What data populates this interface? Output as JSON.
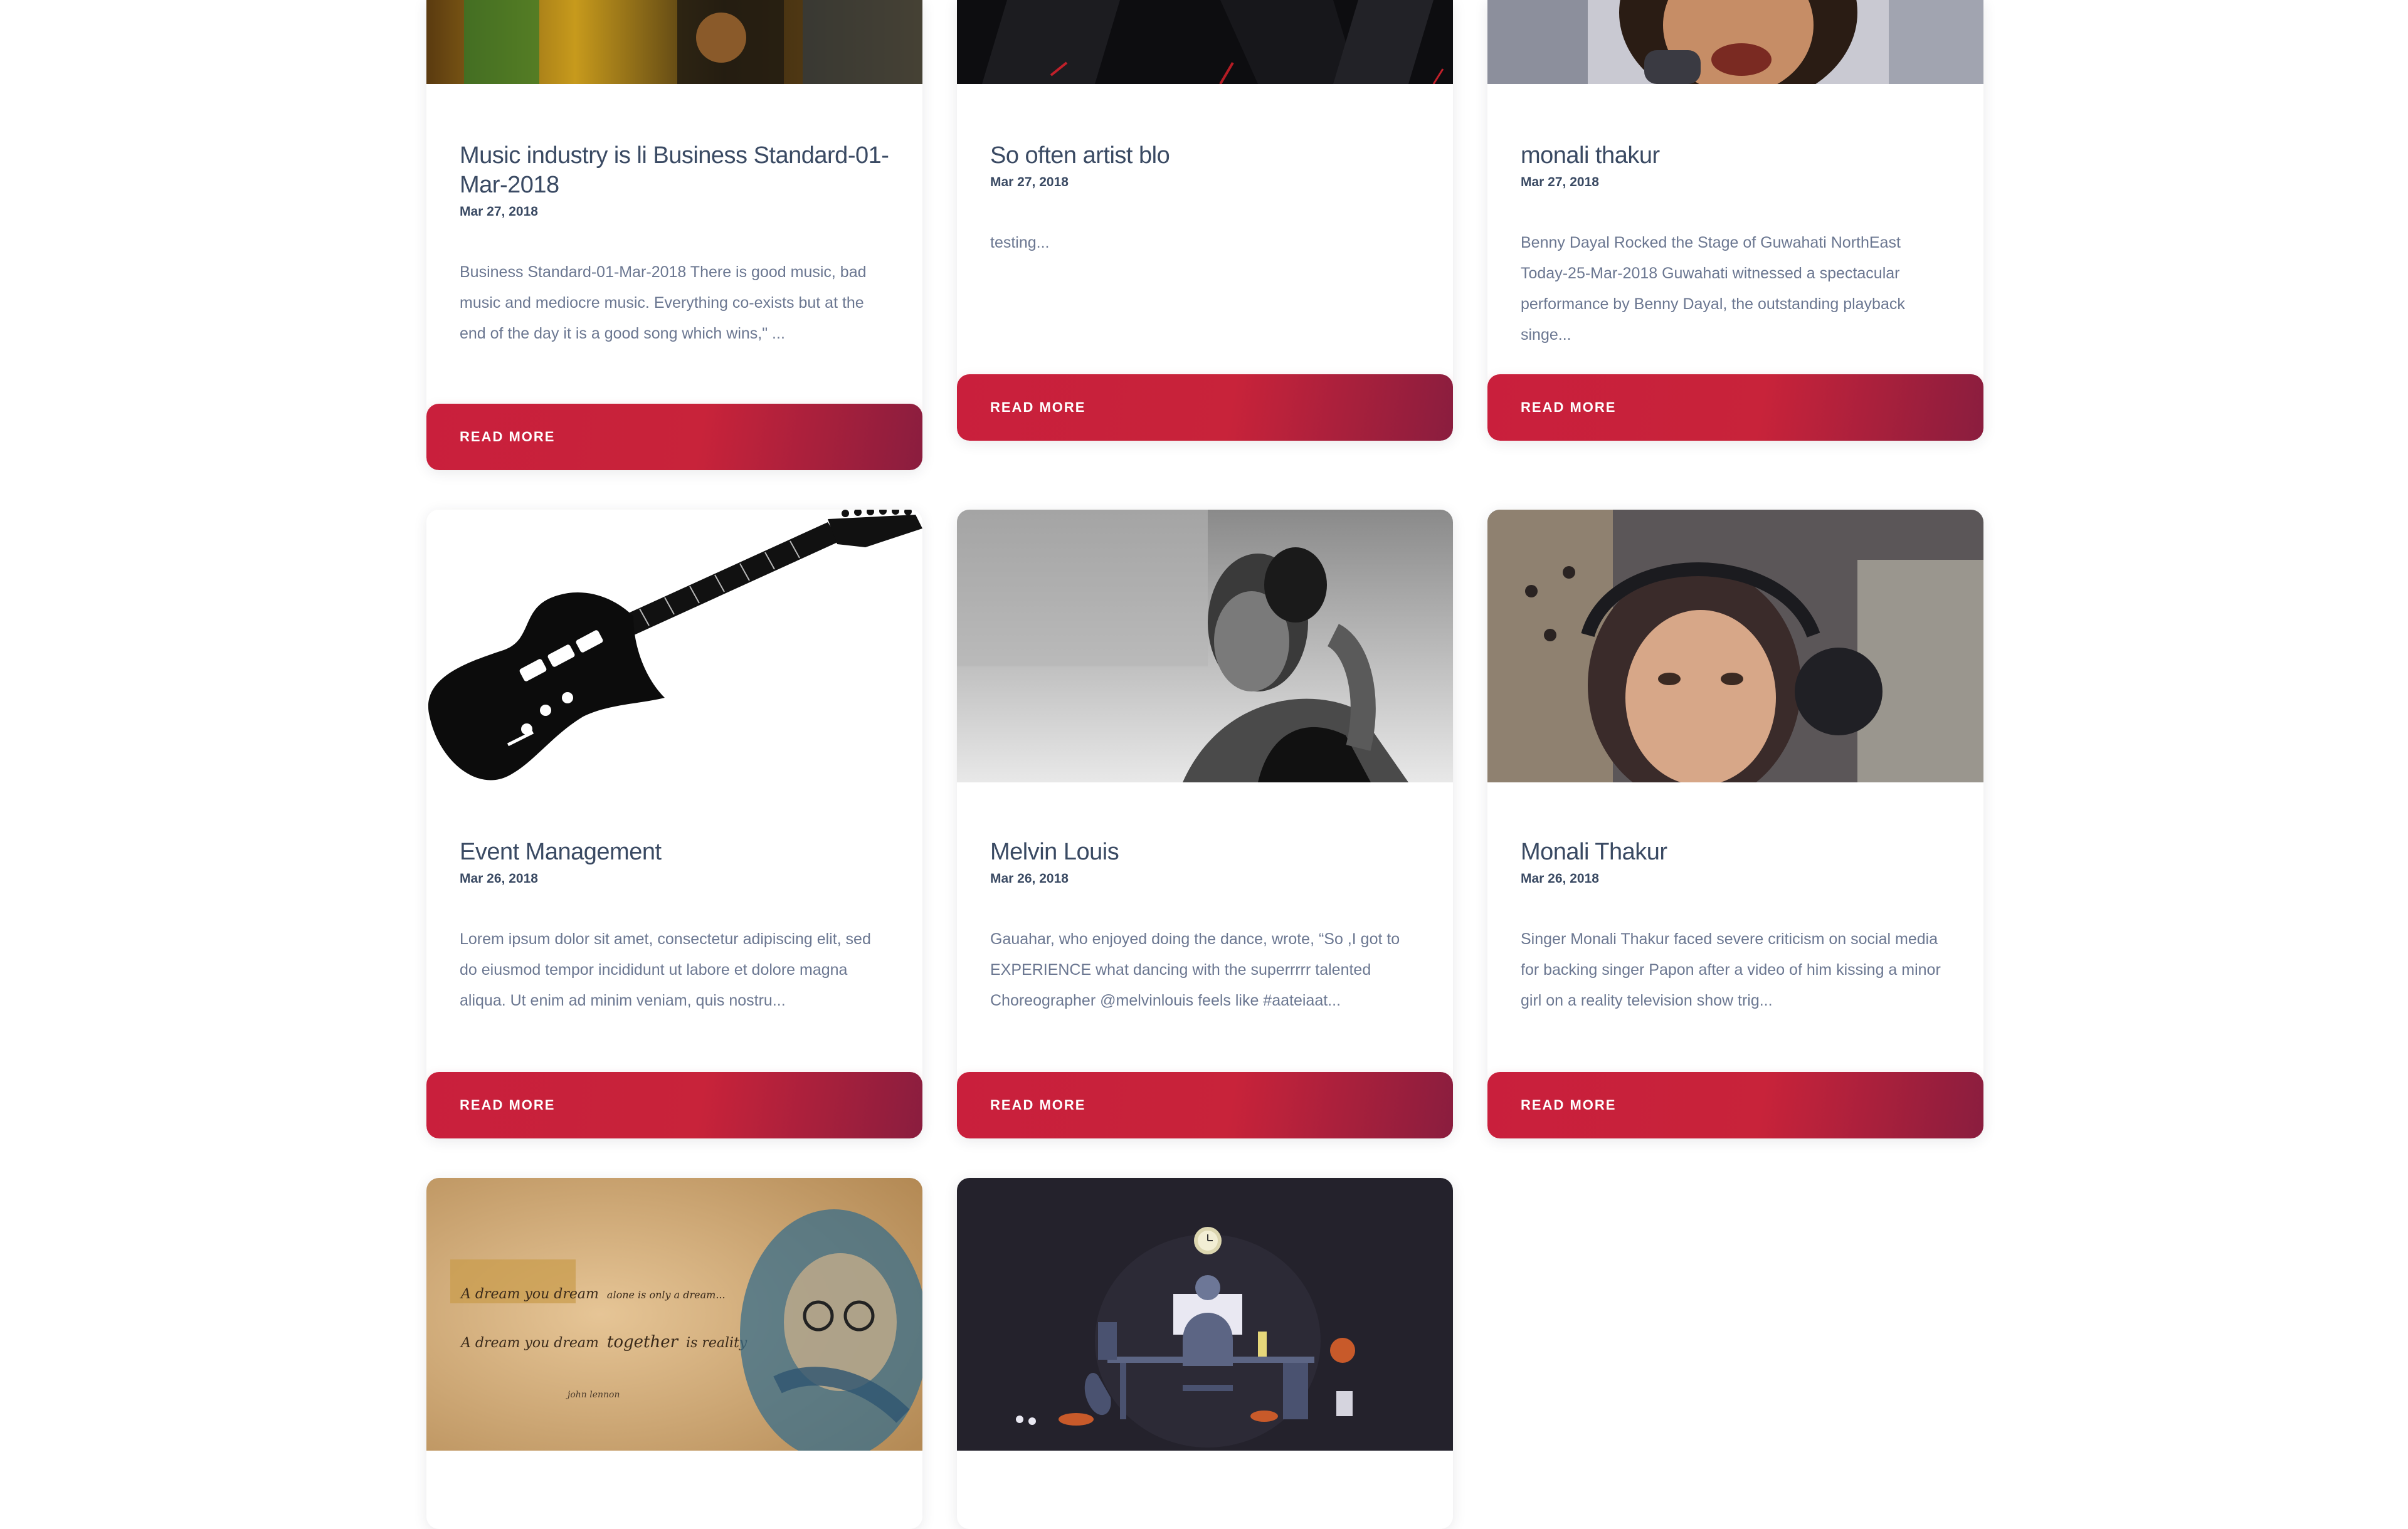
{
  "read_more_label": "READ MORE",
  "colors": {
    "title": "#3a4a63",
    "excerpt": "#6b7791",
    "button_start": "#c91f3c",
    "button_end": "#8a1d3e"
  },
  "posts": [
    {
      "title": "Music industry is li Business Standard-01-Mar-2018",
      "date": "Mar 27, 2018",
      "excerpt": "Business Standard-01-Mar-2018 There is good music, bad music and mediocre music. Everything co-exists but at the end of the day it is a good song which wins,\" ..."
    },
    {
      "title": "So often artist blo",
      "date": "Mar 27, 2018",
      "excerpt": "testing..."
    },
    {
      "title": "monali thakur",
      "date": "Mar 27, 2018",
      "excerpt": "Benny Dayal Rocked the Stage of Guwahati NorthEast Today-25-Mar-2018 Guwahati witnessed a spectacular performance by Benny Dayal, the outstanding playback singe..."
    },
    {
      "title": "Event Management",
      "date": "Mar 26, 2018",
      "excerpt": "Lorem ipsum dolor sit amet, consectetur adipiscing elit, sed do eiusmod tempor incididunt ut labore et dolore magna aliqua. Ut enim ad minim veniam, quis nostru..."
    },
    {
      "title": "Melvin Louis",
      "date": "Mar 26, 2018",
      "excerpt": "Gauahar, who enjoyed doing the dance, wrote, “So ,I got to EXPERIENCE what dancing with the superrrrr talented Choreographer @melvinlouis feels like #aateiaat..."
    },
    {
      "title": "Monali Thakur",
      "date": "Mar 26, 2018",
      "excerpt": "Singer Monali Thakur faced severe criticism on social media for backing singer Papon after a video of him kissing a minor girl on a reality television show trig..."
    }
  ],
  "quote_image": {
    "line1_a": "A dream you dream",
    "line1_b": "alone is only a dream...",
    "line2_a": "A dream you dream",
    "line2_b": "together",
    "line2_c": "is reality",
    "signature": "john lennon"
  }
}
